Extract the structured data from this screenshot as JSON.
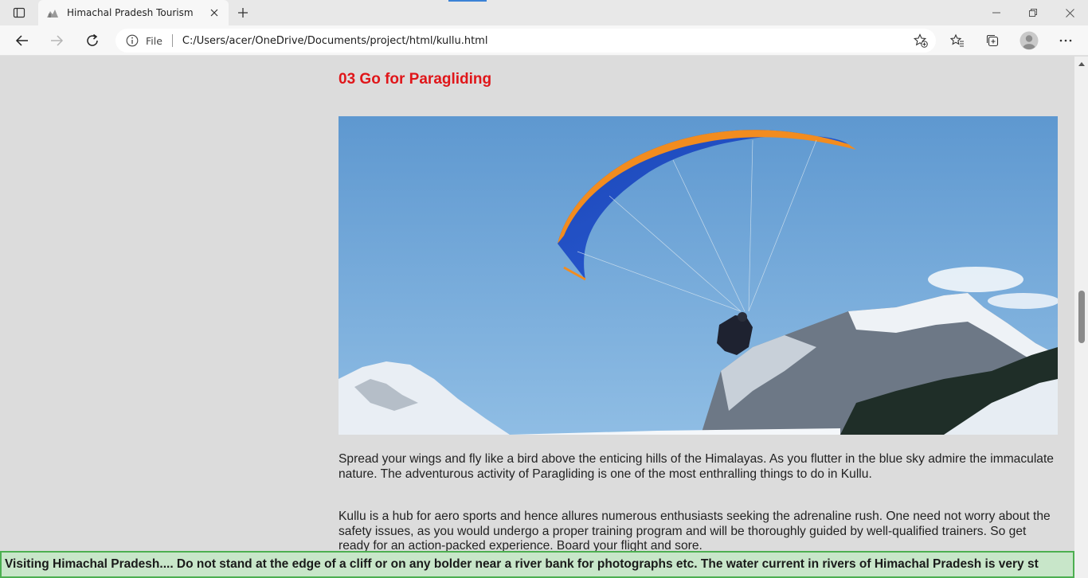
{
  "browser": {
    "tab_title": "Himachal Pradesh Tourism",
    "address": {
      "scheme_label": "File",
      "url": "C:/Users/acer/OneDrive/Documents/project/html/kullu.html"
    },
    "icons": {
      "tab_actions": "tab-actions-icon",
      "favicon": "mountain-favicon-icon",
      "tab_close": "close-icon",
      "new_tab": "plus-icon",
      "minimize": "minimize-icon",
      "restore": "restore-icon",
      "close_window": "close-window-icon",
      "back": "back-arrow-icon",
      "forward": "forward-arrow-icon",
      "refresh": "refresh-icon",
      "info": "info-icon",
      "add_favorite": "star-add-icon",
      "favorites": "favorites-icon",
      "collections": "collections-icon",
      "profile": "profile-avatar-icon",
      "menu": "more-options-icon"
    }
  },
  "page": {
    "heading": "03 Go for Paragliding",
    "paragraphs": [
      "Spread your wings and fly like a bird above the enticing hills of the Himalayas. As you flutter in the blue sky admire the immaculate nature. The adventurous activity of Paragliding is one of the most enthralling things to do in Kullu.",
      "Kullu is a hub for aero sports and hence allures numerous enthusiasts seeking the adrenaline rush. One need not worry about the safety issues, as you would undergo a proper training program and will be thoroughly guided by well-qualified trainers. So get ready for an action-packed experience. Board your flight and sore."
    ],
    "marquee": "Visiting Himachal Pradesh.... Do not stand at the edge of a cliff or on any bolder near a river bank for photographs etc. The water current in rivers of Himachal Pradesh is very st"
  },
  "colors": {
    "heading": "#e0161a",
    "marquee_bg": "#c8e6c9",
    "marquee_border": "#4caf50",
    "page_bg": "#dcdcdc"
  }
}
